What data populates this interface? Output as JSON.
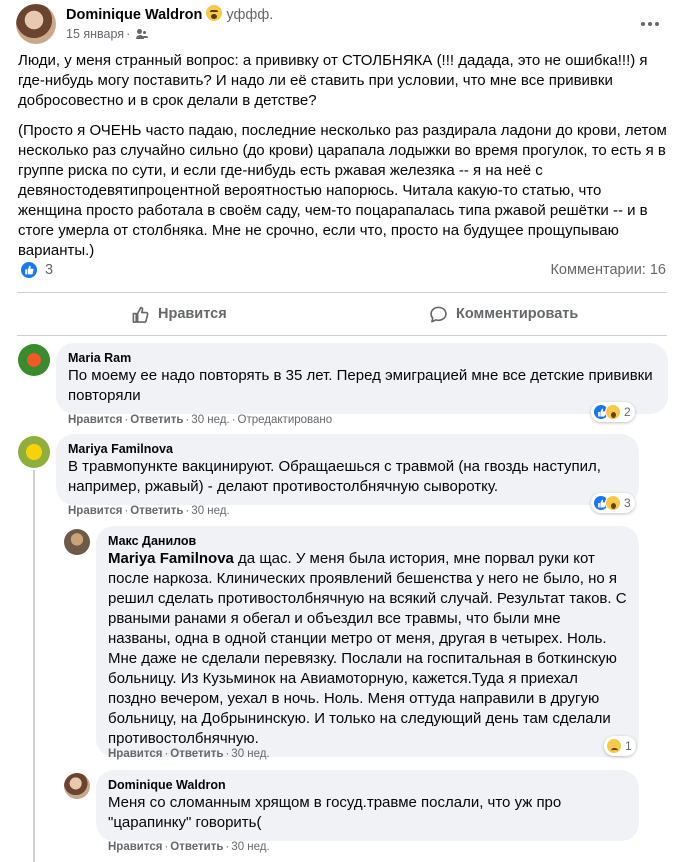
{
  "post": {
    "author": "Dominique Waldron",
    "feeling": "уффф.",
    "date": "15 января",
    "paragraph1": "Люди, у меня странный вопрос: а прививку от СТОЛБНЯКА (!!! дадада, это не ошибка!!!) я где-нибудь могу поставить? И надо ли её ставить при условии, что мне все прививки добросовестно и в срок делали в детстве?",
    "paragraph2": "(Просто я ОЧЕНЬ часто падаю, последние  несколько раз раздирала ладони до крови, летом несколько раз случайно сильно (до крови) царапала лодыжки во время прогулок, то есть я в группе риска по сути, и если где-нибудь есть ржавая железяка -- я на неё с девяностодевятипроцентной вероятностью напорюсь. Читала какую-то статью, что женщина просто работала в своём саду, чем-то поцарапалась типа ржавой решётки  -- и в стоге умерла от столбняка. Мне не срочно, если что, просто на будущее прощупываю варианты.)",
    "reaction_count": "3",
    "comments_count": "Комментарии: 16"
  },
  "actions": {
    "like": "Нравится",
    "comment": "Комментировать"
  },
  "comments": [
    {
      "name": "Maria Ram",
      "text": "По моему ее надо повторять в 35 лет. Перед эмиграцией мне все детские прививки повторяли",
      "like": "Нравится",
      "reply": "Ответить",
      "time": "30 нед.",
      "edited": "Отредактировано",
      "reactions": "2"
    },
    {
      "name": "Mariya Familnova",
      "text": "В травмопункте вакцинируют. Обращаешься с травмой (на гвоздь наступил, например, ржавый) - делают противостолбнячную сыворотку.",
      "like": "Нравится",
      "reply": "Ответить",
      "time": "30 нед.",
      "reactions": "3"
    },
    {
      "name": "Макс Данилов",
      "mention": "Mariya Familnova",
      "text": " да щас. У меня была история, мне порвал руки кот после наркоза. Клинических проявлений бешенства у него не было, но я решил сделать противостолбнячную на всякий случай. Результат таков. С рваными ранами я обегал и объездил все травмы, что были мне названы, одна в одной станции метро от меня, другая в четырех. Ноль. Мне даже не сделали перевязку. Послали на госпитальная в боткинскую больницу. Из Кузьминок на Авиамоторную, кажется.Туда я приехал поздно вечером, уехал в ночь. Ноль. Меня оттуда направили в другую больницу, на Добрынинскую. И только на следующий день там сделали противостолбнячную.",
      "like": "Нравится",
      "reply": "Ответить",
      "time": "30 нед.",
      "reactions": "1"
    },
    {
      "name": "Dominique Waldron",
      "text": "Меня со сломанным хрящом в госуд.травме послали, что уж про \"царапинку\" говорить(",
      "like": "Нравится",
      "reply": "Ответить",
      "time": "30 нед."
    }
  ],
  "colors": {
    "accent": "#1877f2",
    "secondary_text": "#65676b",
    "bubble": "#f0f2f5"
  }
}
